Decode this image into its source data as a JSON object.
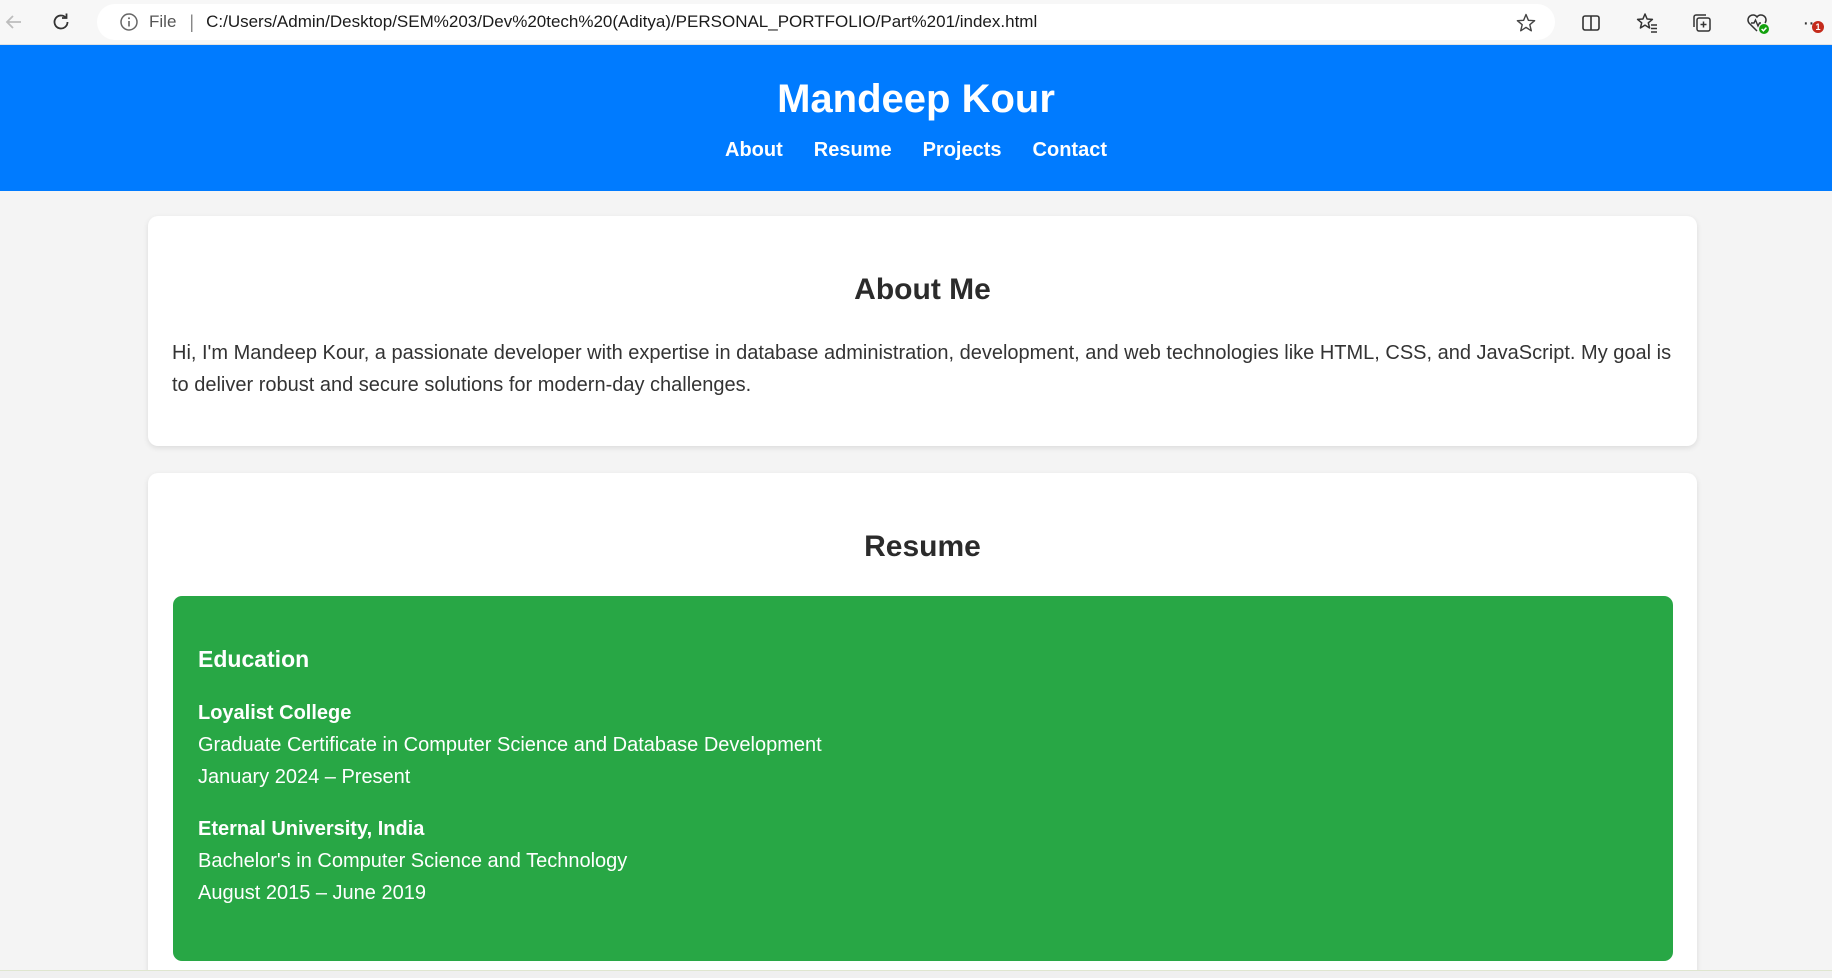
{
  "browser": {
    "file_label": "File",
    "separator": "|",
    "url": "C:/Users/Admin/Desktop/SEM%203/Dev%20tech%20(Aditya)/PERSONAL_PORTFOLIO/Part%201/index.html",
    "notification_count": "1",
    "menu_label": "···",
    "icons": [
      "back-icon",
      "refresh-icon",
      "info-icon",
      "favorite-star-icon",
      "split-screen-icon",
      "favorites-icon",
      "collections-icon",
      "browser-essentials-icon",
      "more-menu-icon"
    ]
  },
  "header": {
    "name": "Mandeep Kour",
    "nav": [
      "About",
      "Resume",
      "Projects",
      "Contact"
    ]
  },
  "about": {
    "heading": "About Me",
    "text": "Hi, I'm Mandeep Kour, a passionate developer with expertise in database administration, development, and web technologies like HTML, CSS, and JavaScript. My goal is to deliver robust and secure solutions for modern-day challenges."
  },
  "resume": {
    "heading": "Resume",
    "education": {
      "title": "Education",
      "items": [
        {
          "school": "Loyalist College",
          "program": "Graduate Certificate in Computer Science and Database Development",
          "dates": "January 2024 – Present"
        },
        {
          "school": "Eternal University, India",
          "program": "Bachelor's in Computer Science and Technology",
          "dates": "August 2015 – June 2019"
        }
      ]
    }
  },
  "colors": {
    "header_bg": "#007bff",
    "education_bg": "#28a745",
    "page_bg": "#f4f4f4",
    "card_bg": "#ffffff"
  }
}
